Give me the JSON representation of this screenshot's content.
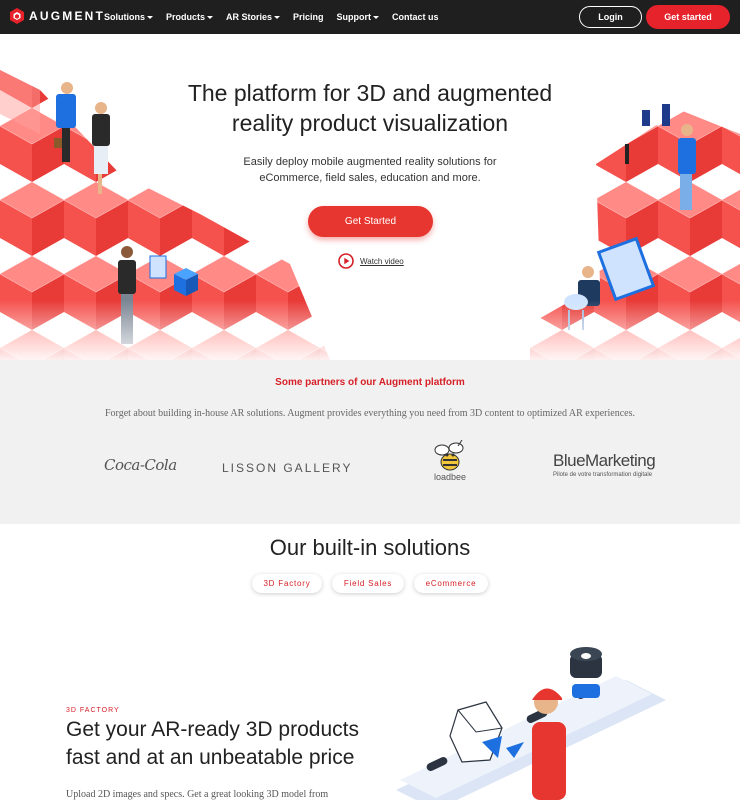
{
  "brand": {
    "name": "AUGMENT",
    "accent": "#e6222b",
    "nav_bg": "#1f1f1f"
  },
  "nav": {
    "items": [
      {
        "label": "Solutions",
        "dropdown": true
      },
      {
        "label": "Products",
        "dropdown": true
      },
      {
        "label": "AR Stories",
        "dropdown": true
      },
      {
        "label": "Pricing",
        "dropdown": false
      },
      {
        "label": "Support",
        "dropdown": true
      },
      {
        "label": "Contact us",
        "dropdown": false
      }
    ],
    "login_label": "Login",
    "cta_label": "Get started"
  },
  "hero": {
    "title": "The platform for 3D and augmented reality product visualization",
    "subtitle": "Easily deploy mobile augmented reality solutions for eCommerce, field sales, education and more.",
    "cta_label": "Get Started",
    "watch_label": "Watch video"
  },
  "partners": {
    "title": "Some partners of our Augment platform",
    "subtitle": "Forget about building in-house AR solutions. Augment provides everything you need from 3D content to optimized AR experiences.",
    "logos": {
      "coke": "Coca-Cola",
      "lisson": "LISSON GALLERY",
      "loadbee": "loadbee",
      "blue_name": "BlueMarketing",
      "blue_tagline": "Pilote de votre transformation digitale"
    }
  },
  "solutions": {
    "title": "Our built-in solutions",
    "tabs": [
      "3D Factory",
      "Field Sales",
      "eCommerce"
    ]
  },
  "feature": {
    "kicker": "3D FACTORY",
    "title": "Get your AR-ready 3D products fast and at an unbeatable price",
    "description": "Upload 2D images and specs. Get a great looking 3D model from"
  }
}
